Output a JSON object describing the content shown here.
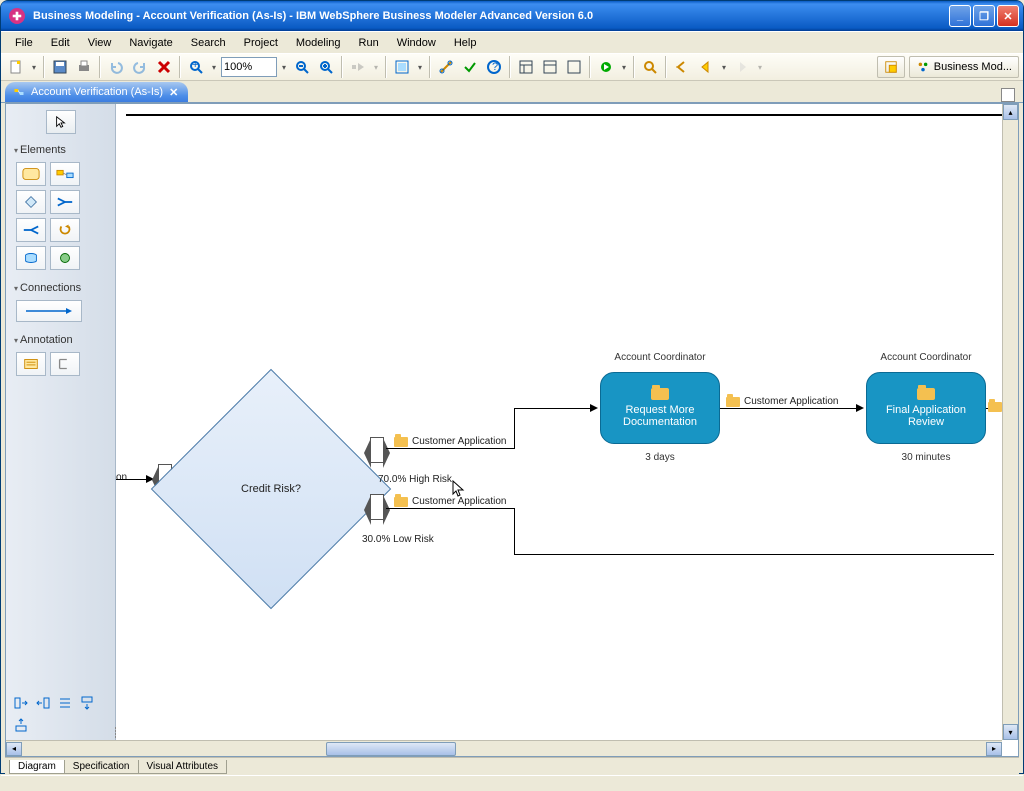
{
  "window": {
    "title": "Business Modeling - Account Verification (As-Is) - IBM WebSphere Business Modeler Advanced Version 6.0"
  },
  "menu": [
    "File",
    "Edit",
    "View",
    "Navigate",
    "Search",
    "Project",
    "Modeling",
    "Run",
    "Window",
    "Help"
  ],
  "toolbar": {
    "zoom": "100%",
    "perspective": "Business Mod..."
  },
  "editorTab": "Account Verification (As-Is)",
  "palette": {
    "sect1": "Elements",
    "sect2": "Connections",
    "sect3": "Annotation"
  },
  "diagram": {
    "incoming_cut": "on",
    "decision": "Credit Risk?",
    "branch_high_label": "70.0% High Risk",
    "branch_low_label": "30.0% Low Risk",
    "conn_app1": "Customer Application",
    "conn_app2": "Customer Application",
    "conn_app3": "Customer Application",
    "task1": {
      "role": "Account Coordinator",
      "name": "Request More Documentation",
      "time": "3 days"
    },
    "task2": {
      "role": "Account Coordinator",
      "name": "Final Application Review",
      "time": "30 minutes"
    }
  },
  "bottomTabs": [
    "Diagram",
    "Specification",
    "Visual Attributes"
  ]
}
